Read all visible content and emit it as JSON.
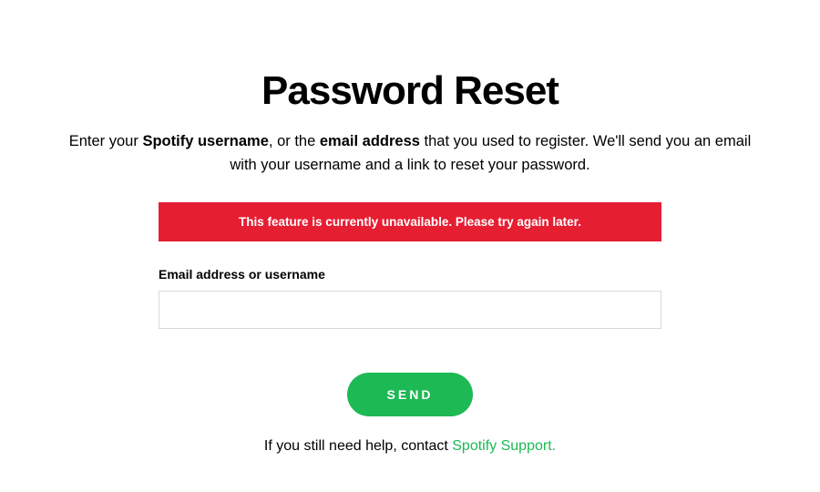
{
  "title": "Password Reset",
  "instructions": {
    "part1": "Enter your ",
    "bold1": "Spotify username",
    "part2": ", or the ",
    "bold2": "email address",
    "part3": " that you used to register. We'll send you an email with your username and a link to reset your password."
  },
  "error": {
    "message": "This feature is currently unavailable. Please try again later."
  },
  "form": {
    "label": "Email address or username",
    "value": ""
  },
  "button": {
    "send": "SEND"
  },
  "help": {
    "prefix": "If you still need help, contact ",
    "link": "Spotify Support."
  },
  "colors": {
    "accent": "#1db954",
    "error": "#e61e32"
  }
}
